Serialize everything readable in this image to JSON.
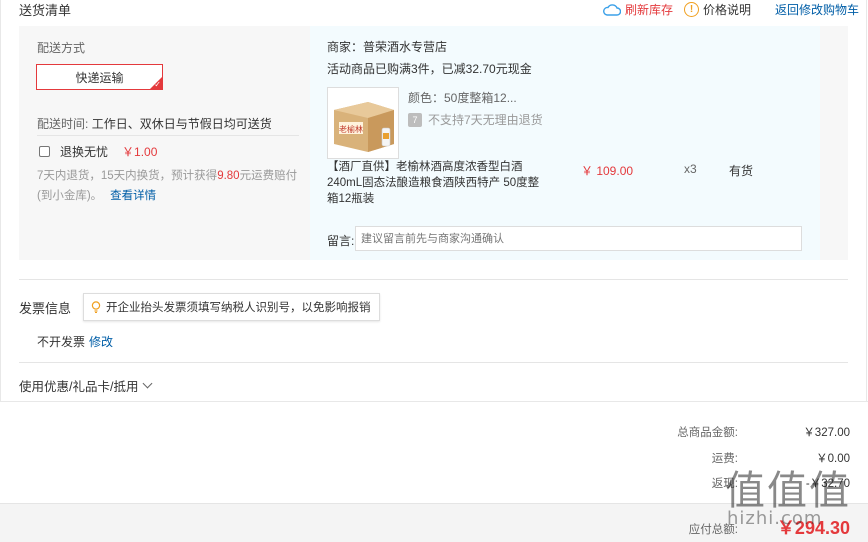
{
  "header": {
    "title": "送货清单",
    "refresh_label": "刷新库存",
    "price_label": "价格说明",
    "back_label": "返回修改购物车"
  },
  "shipping": {
    "method_label": "配送方式",
    "express_label": "快递运输",
    "time_label": "配送时间:",
    "time_value": "工作日、双休日与节假日均可送货",
    "return_label": "退换无忧",
    "return_price": "￥1.00",
    "return_desc_pre": "7天内退货，15天内换货，预计获得",
    "return_desc_amount": "9.80",
    "return_desc_post": "元运费赔付(到小金库)。",
    "detail_link": "查看详情"
  },
  "product": {
    "merchant": "商家：普荣酒水专营店",
    "promo": "活动商品已购满3件，已减32.70元现金",
    "color": "颜色：50度整箱12...",
    "no_return": "不支持7天无理由退货",
    "title": "【酒厂直供】老榆林酒高度浓香型白酒240mL固态法酿造粮食酒陕西特产 50度整箱12瓶装",
    "price": "￥ 109.00",
    "qty": "x3",
    "stock": "有货",
    "image_text": "老榆林",
    "memo_label": "留言:",
    "memo_placeholder": "建议留言前先与商家沟通确认"
  },
  "invoice": {
    "title": "发票信息",
    "tip": "开企业抬头发票须填写纳税人识别号，以免影响报销",
    "value": "不开发票",
    "modify": "修改"
  },
  "coupon": {
    "label": "使用优惠/礼品卡/抵用"
  },
  "totals": {
    "goods_label": "总商品金额:",
    "goods_value": "￥327.00",
    "freight_label": "运费:",
    "freight_value": "￥0.00",
    "rebate_label": "返现:",
    "rebate_value": "-￥32.70",
    "pay_label": "应付总额:",
    "pay_value": "￥294.30"
  },
  "watermark": {
    "main": "值值值",
    "sub": "hizhi.com"
  },
  "colors": {
    "accent_red": "#e4393c",
    "link_blue": "#005ea7"
  }
}
